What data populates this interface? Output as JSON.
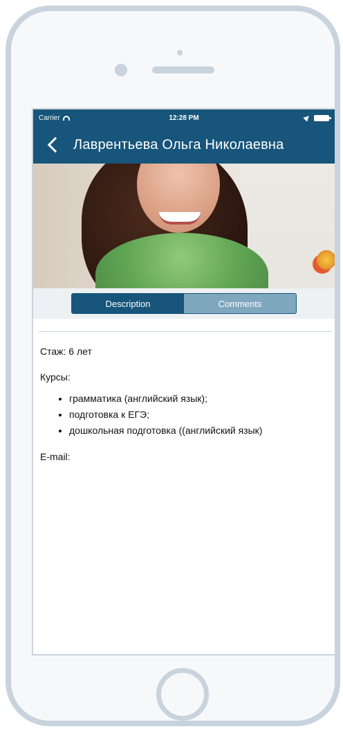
{
  "status_bar": {
    "carrier": "Carrier",
    "time": "12:28 PM"
  },
  "nav_bar": {
    "title": "Лаврентьева Ольга Николаевна"
  },
  "tabs": {
    "description": "Description",
    "comments": "Comments",
    "active": "description"
  },
  "profile": {
    "experience": "Стаж: 6 лет",
    "courses_label": "Курсы:",
    "courses": [
      "грамматика (английский язык);",
      "подготовка к ЕГЭ;",
      "дошкольная подготовка ((английский язык)"
    ],
    "email_label": "E-mail:"
  },
  "colors": {
    "primary": "#17557a",
    "tab_inactive": "#7fa7bd",
    "frame": "#c9d3dd"
  },
  "icons": {
    "back": "chevron-left-icon",
    "wifi": "wifi-icon",
    "battery": "battery-icon",
    "location": "location-icon"
  }
}
